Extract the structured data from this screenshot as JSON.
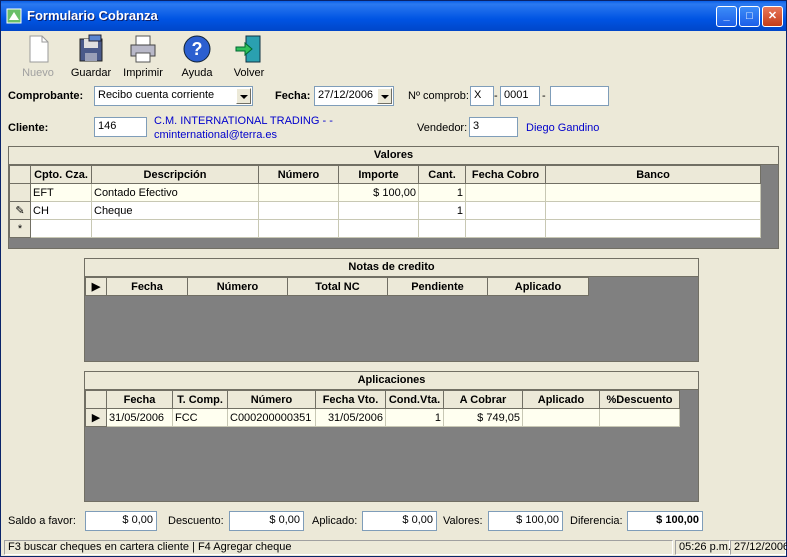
{
  "window": {
    "title": "Formulario Cobranza"
  },
  "toolbar": {
    "nuevo": "Nuevo",
    "guardar": "Guardar",
    "imprimir": "Imprimir",
    "ayuda": "Ayuda",
    "volver": "Volver"
  },
  "form": {
    "comprobante_label": "Comprobante:",
    "comprobante_value": "Recibo cuenta corriente",
    "fecha_label": "Fecha:",
    "fecha_value": "27/12/2006",
    "ncomprob_label": "Nº comprob:",
    "ncomprob_letra": "X",
    "ncomprob_sep1": "-",
    "ncomprob_pv": "0001",
    "ncomprob_sep2": "-",
    "ncomprob_num": "",
    "cliente_label": "Cliente:",
    "cliente_value": "146",
    "cliente_name": "C.M. INTERNATIONAL TRADING -  -",
    "cliente_email": "cminternational@terra.es",
    "vendedor_label": "Vendedor:",
    "vendedor_value": "3",
    "vendedor_name": "Diego Gandino"
  },
  "valores": {
    "caption": "Valores",
    "columns": [
      "",
      "Cpto. Cza.",
      "Descripción",
      "Número",
      "Importe",
      "Cant.",
      "Fecha Cobro",
      "Banco"
    ],
    "rows": [
      [
        "",
        "EFT",
        "Contado Efectivo",
        "",
        "$ 100,00",
        "1",
        "",
        ""
      ],
      [
        "✎",
        "CH",
        "Cheque",
        "",
        "",
        "1",
        "",
        ""
      ],
      [
        "*",
        "",
        "",
        "",
        "",
        "",
        "",
        ""
      ]
    ]
  },
  "notas": {
    "caption": "Notas de credito",
    "columns": [
      "",
      "Fecha",
      "Número",
      "Total NC",
      "Pendiente",
      "Aplicado"
    ]
  },
  "aplicaciones": {
    "caption": "Aplicaciones",
    "columns": [
      "",
      "Fecha",
      "T. Comp.",
      "Número",
      "Fecha Vto.",
      "Cond.Vta.",
      "A Cobrar",
      "Aplicado",
      "%Descuento"
    ],
    "rows": [
      [
        "▶",
        "31/05/2006",
        "FCC",
        "C000200000351",
        "31/05/2006",
        "1",
        "$ 749,05",
        "",
        ""
      ]
    ]
  },
  "totals": {
    "saldo_label": "Saldo a favor:",
    "saldo_value": "$ 0,00",
    "descuento_label": "Descuento:",
    "descuento_value": "$ 0,00",
    "aplicado_label": "Aplicado:",
    "aplicado_value": "$ 0,00",
    "valores_label": "Valores:",
    "valores_value": "$ 100,00",
    "diferencia_label": "Diferencia:",
    "diferencia_value": "$ 100,00"
  },
  "status": {
    "hint": "F3 buscar cheques en cartera cliente | F4 Agregar cheque",
    "time": "05:26 p.m.",
    "date": "27/12/2006"
  }
}
